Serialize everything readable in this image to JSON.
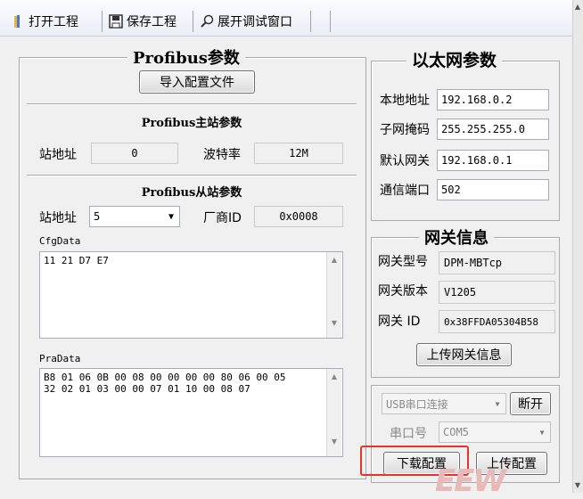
{
  "toolbar": {
    "open_label": "打开工程",
    "save_label": "保存工程",
    "debug_label": "展开调试窗口"
  },
  "profibus": {
    "title": "Profibus参数",
    "import_button": "导入配置文件",
    "master_title": "Profibus主站参数",
    "master_station_label": "站地址",
    "master_station_value": "0",
    "baud_label": "波特率",
    "baud_value": "12M",
    "slave_title": "Profibus从站参数",
    "slave_station_label": "站地址",
    "slave_station_value": "5",
    "vendor_label": "厂商ID",
    "vendor_value": "0x0008",
    "cfg_label": "CfgData",
    "cfg_value": "11 21 D7 E7",
    "pra_label": "PraData",
    "pra_value": "B8 01 06 0B 00 08 00 00 00 00 80 06 00 05\n32 02 01 03 00 00 07 01 10 00 08 07"
  },
  "ethernet": {
    "title": "以太网参数",
    "local_label": "本地地址",
    "local_value": "192.168.0.2",
    "mask_label": "子网掩码",
    "mask_value": "255.255.255.0",
    "gateway_label": "默认网关",
    "gateway_value": "192.168.0.1",
    "port_label": "通信端口",
    "port_value": "502"
  },
  "gateway_info": {
    "title": "网关信息",
    "model_label": "网关型号",
    "model_value": "DPM-MBTcp",
    "version_label": "网关版本",
    "version_value": "V1205",
    "id_label": "网关 ID",
    "id_value": "0x38FFDA05304B58",
    "upload_button": "上传网关信息"
  },
  "connection": {
    "mode_value": "USB串口连接",
    "disconnect_button": "断开",
    "port_label": "串口号",
    "port_value": "COM5",
    "download_button": "下载配置",
    "upload_button": "上传配置"
  },
  "colors": {
    "highlight": "#e8332a"
  },
  "watermark": "EEW"
}
